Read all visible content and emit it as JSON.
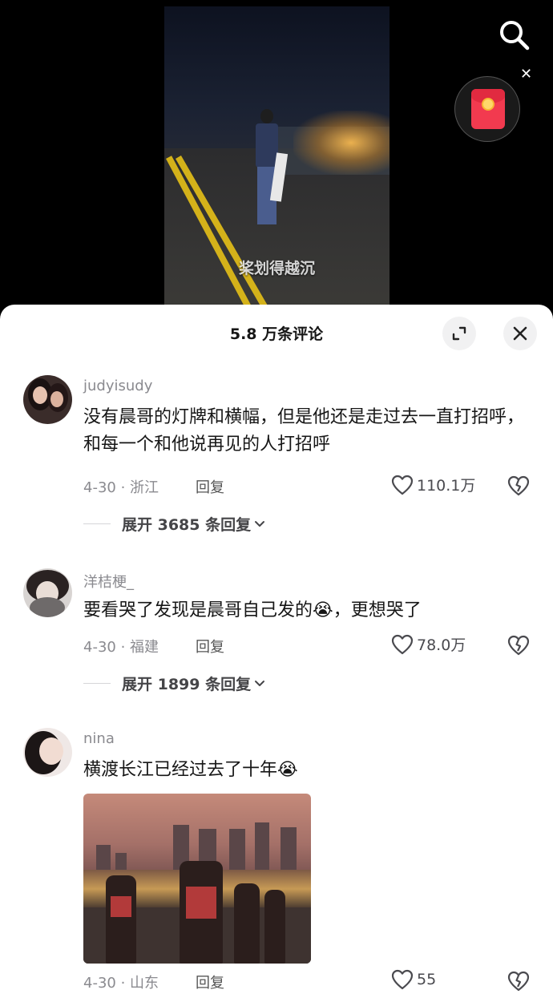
{
  "video": {
    "caption": "桨划得越沉"
  },
  "icons": {
    "search": "search-icon",
    "redpacket": "red-envelope-icon",
    "close_small": "close-icon",
    "expand": "expand-icon",
    "close": "close-icon",
    "like": "heart-icon",
    "dislike": "broken-heart-icon",
    "chevron": "chevron-down-icon",
    "crying_emoji": "😭"
  },
  "sheet": {
    "title": "5.8 万条评论"
  },
  "comments": [
    {
      "username": "judyisudy",
      "text": "没有晨哥的灯牌和横幅，但是他还是走过去一直打招呼，和每一个和他说再见的人打招呼",
      "date_location": "4-30 · 浙江",
      "reply_label": "回复",
      "likes": "110.1万",
      "expand_label": "展开 3685 条回复"
    },
    {
      "username": "洋桔梗_",
      "text_before": "要看哭了发现是晨哥自己发的",
      "emoji": "😭",
      "text_after": "，更想哭了",
      "date_location": "4-30 · 福建",
      "reply_label": "回复",
      "likes": "78.0万",
      "expand_label": "展开 1899 条回复"
    },
    {
      "username": "nina",
      "text_before": "横渡长江已经过去了十年",
      "emoji": "😭",
      "date_location": "4-30 · 山东",
      "reply_label": "回复",
      "likes": "55"
    }
  ],
  "colors": {
    "background": "#000000",
    "sheet": "#ffffff",
    "muted_text": "#8a8a8f",
    "red_envelope": "#f23a4f"
  }
}
